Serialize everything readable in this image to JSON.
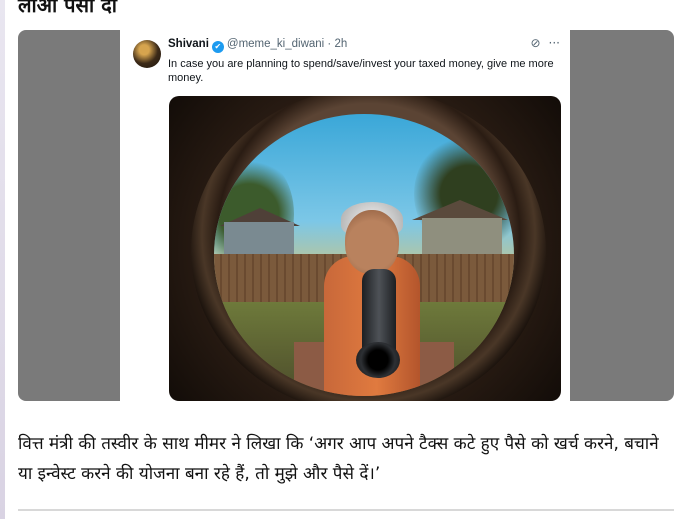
{
  "article": {
    "headline": "लाओ पैसा दो",
    "caption": "वित्त मंत्री की तस्वीर के साथ मीमर ने लिखा कि ‘अगर आप अपने टैक्स कटे हुए पैसे को खर्च करने, बचाने या इन्वेस्ट करने की योजना बना रहे हैं, तो मुझे और पैसे दें।’"
  },
  "tweet": {
    "author_name": "Shivani",
    "verified_icon": "✔",
    "handle_time": "@meme_ki_diwani · 2h",
    "text": "In case you are planning to spend/save/invest your taxed money, give me more money.",
    "grok_icon": "⊘",
    "more_icon": "···"
  }
}
